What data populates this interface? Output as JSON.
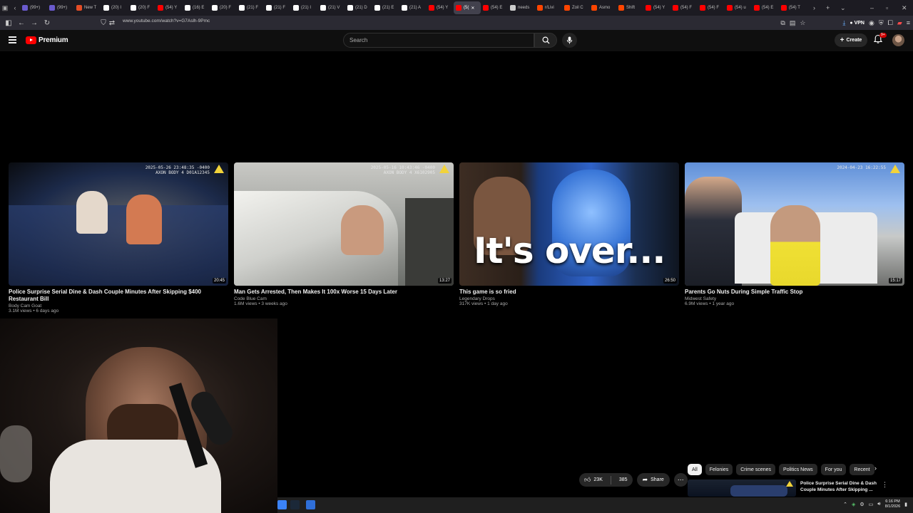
{
  "browser": {
    "tabs": [
      {
        "label": "(99+)",
        "color": "#6a5acd"
      },
      {
        "label": "(99+)",
        "color": "#6a5acd"
      },
      {
        "label": "New T",
        "color": "#e44d26"
      },
      {
        "label": "(20) I",
        "color": "#ffffff"
      },
      {
        "label": "(20) F",
        "color": "#ffffff"
      },
      {
        "label": "(54) Y",
        "color": "#ff0000"
      },
      {
        "label": "(16) E",
        "color": "#ffffff"
      },
      {
        "label": "(20) F",
        "color": "#ffffff"
      },
      {
        "label": "(21) F",
        "color": "#ffffff"
      },
      {
        "label": "(21) F",
        "color": "#ffffff"
      },
      {
        "label": "(21) I",
        "color": "#ffffff"
      },
      {
        "label": "(21) V",
        "color": "#ffffff"
      },
      {
        "label": "(21) D",
        "color": "#ffffff"
      },
      {
        "label": "(21) E",
        "color": "#ffffff"
      },
      {
        "label": "(21) A",
        "color": "#ffffff"
      },
      {
        "label": "(54) Y",
        "color": "#ff0000"
      },
      {
        "label": "(5(",
        "color": "#ff0000",
        "active": true
      },
      {
        "label": "(54) E",
        "color": "#ff0000"
      },
      {
        "label": "needs",
        "color": "#cccccc"
      },
      {
        "label": "r/Livi",
        "color": "#ff4500"
      },
      {
        "label": "Zoil C",
        "color": "#ff4500"
      },
      {
        "label": "Asmo",
        "color": "#ff4500"
      },
      {
        "label": "Shift",
        "color": "#ff4500"
      },
      {
        "label": "(54) Y",
        "color": "#ff0000"
      },
      {
        "label": "(54) F",
        "color": "#ff0000"
      },
      {
        "label": "(54) F",
        "color": "#ff0000"
      },
      {
        "label": "(54) u",
        "color": "#ff0000"
      },
      {
        "label": "(54) E",
        "color": "#ff0000"
      },
      {
        "label": "(54) T",
        "color": "#ff0000"
      }
    ],
    "url": "www.youtube.com/watch?v=G7Aslh-9Pmc",
    "vpn_label": "VPN"
  },
  "youtube": {
    "logo_text": "Premium",
    "search_placeholder": "Search",
    "create_label": "Create",
    "notification_badge": "9+"
  },
  "videos": [
    {
      "title": "Police Surprise Serial Dine & Dash Couple Minutes After Skipping $400 Restaurant Bill",
      "channel": "Body Cam Goat",
      "meta": "3.1M views • 6 days ago",
      "duration": "20:45",
      "stamp": "2025-05-26 23:48:35 -0400\nAXON BODY 4 D01A12345"
    },
    {
      "title": "Man Gets Arrested, Then Makes It 100x Worse 15 Days Later",
      "channel": "Code Blue Cam",
      "meta": "1.6M views • 3 weeks ago",
      "duration": "13:27",
      "stamp": "2025-05-16 10:43:46 -0400\nAXON BODY 4 X6102905"
    },
    {
      "title": "This game is so fried",
      "channel": "Legendary Drops",
      "meta": "317K views • 1 day ago",
      "duration": "26:50",
      "overlay_text": "It's over..."
    },
    {
      "title": "Parents Go Nuts During Simple Traffic Stop",
      "channel": "Midwest Safety",
      "meta": "6.9M views • 1 year ago",
      "duration": "15:17",
      "stamp": "2024-04-23 16:22:55"
    }
  ],
  "actions": {
    "likes": "23K",
    "dislikes": "385",
    "share_label": "Share"
  },
  "chips": [
    "All",
    "Felonies",
    "Crime scenes",
    "Politics News",
    "For you",
    "Recent"
  ],
  "next_video": {
    "title": "Police Surprise Serial Dine & Dash Couple Minutes After Skipping ..."
  },
  "taskbar": {
    "time": "6:16 PM",
    "date": "8/1/2026"
  }
}
